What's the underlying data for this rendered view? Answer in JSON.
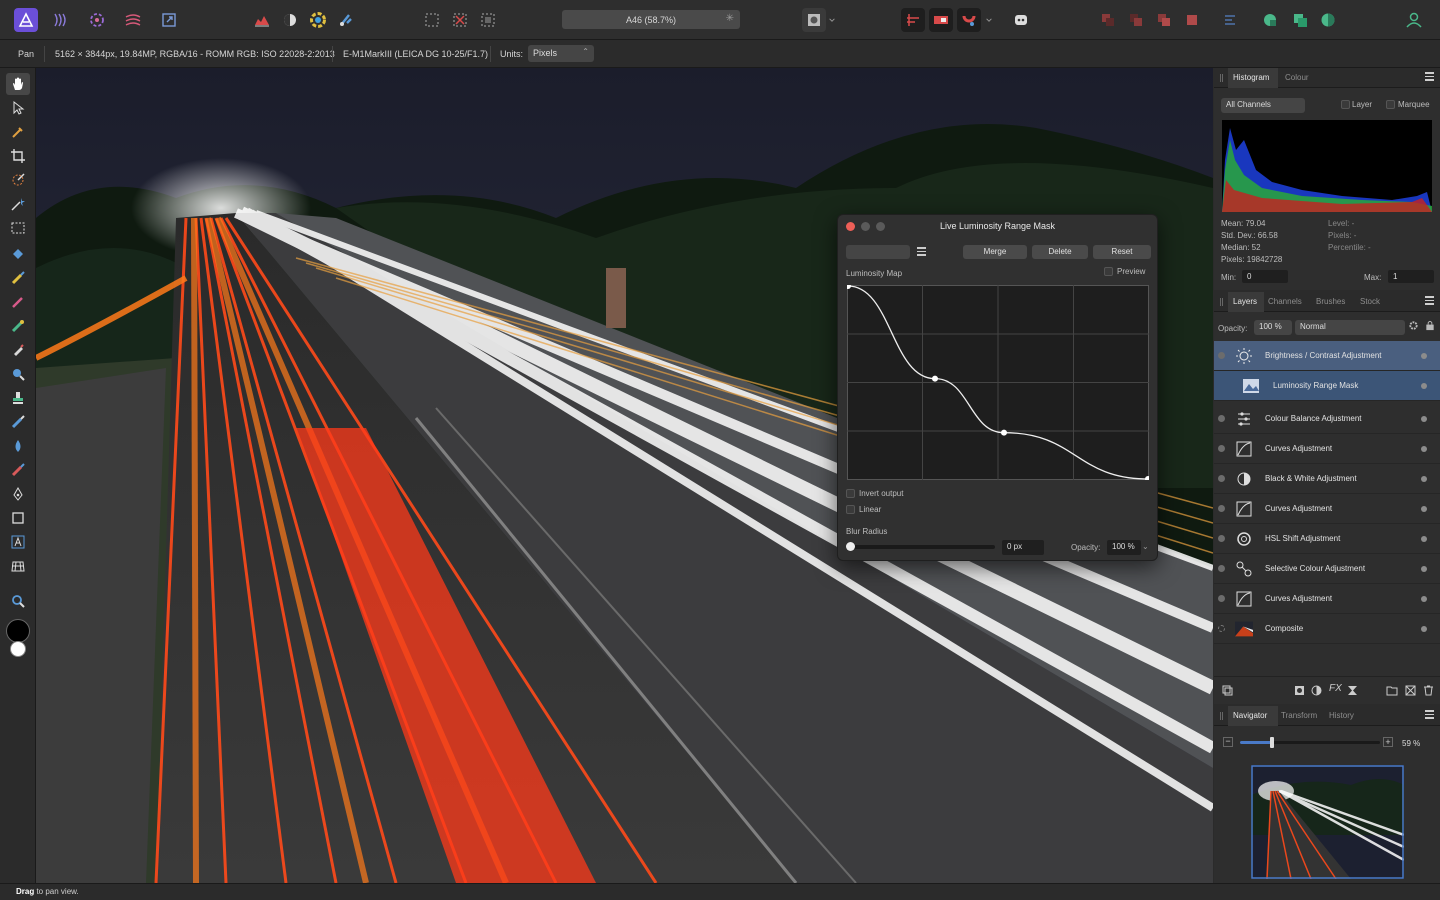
{
  "toolbar_top": {
    "document_title": "A46 (58.7%)",
    "icons": [
      "affinity-photo-logo-icon",
      "liquify-persona-icon",
      "develop-persona-icon",
      "tone-mapping-persona-icon",
      "export-persona-icon",
      "histogram-view-icon",
      "mask-icon",
      "colour-wheel-icon",
      "brush-icon",
      "marquee-select-icon",
      "remove-selection-icon",
      "invert-selection-icon",
      "quick-mask-icon",
      "snapping-icon",
      "view-mode-icon",
      "assistant-icon",
      "arrange-icons",
      "panel-icons",
      "user-icon"
    ]
  },
  "context_bar": {
    "tool": "Pan",
    "image_info": "5162 × 3844px, 19.84MP, RGBA/16 - ROMM RGB: ISO 22028-2:2013",
    "camera": "E-M1MarkIII (LEICA DG 10-25/F1.7)",
    "units_label": "Units:",
    "units_value": "Pixels"
  },
  "status_bar": {
    "bold": "Drag",
    "text": " to pan view."
  },
  "histogram_panel": {
    "tabs": [
      "Histogram",
      "Colour"
    ],
    "channel": "All Channels",
    "layer_label": "Layer",
    "marquee_label": "Marquee",
    "stats_left": [
      "Mean: 79.04",
      "Std. Dev.: 66.58",
      "Median: 52",
      "Pixels: 19842728"
    ],
    "stats_right": [
      "Level: -",
      "Pixels: -",
      "Percentile: -"
    ],
    "min_label": "Min:",
    "min_value": "0",
    "max_label": "Max:",
    "max_value": "1"
  },
  "layers_panel": {
    "tabs": [
      "Layers",
      "Channels",
      "Brushes",
      "Stock"
    ],
    "opacity_label": "Opacity:",
    "opacity_value": "100 %",
    "blend_mode": "Normal",
    "layers": [
      {
        "name": "Brightness / Contrast Adjustment",
        "icon": "brightness-contrast-icon"
      },
      {
        "name": "Luminosity Range Mask",
        "icon": "luminosity-range-mask-icon"
      },
      {
        "name": "Colour Balance Adjustment",
        "icon": "colour-balance-icon"
      },
      {
        "name": "Curves Adjustment",
        "icon": "curves-icon"
      },
      {
        "name": "Black & White Adjustment",
        "icon": "black-white-icon"
      },
      {
        "name": "Curves Adjustment",
        "icon": "curves-icon"
      },
      {
        "name": "HSL Shift Adjustment",
        "icon": "hsl-shift-icon"
      },
      {
        "name": "Selective Colour Adjustment",
        "icon": "selective-colour-icon"
      },
      {
        "name": "Curves Adjustment",
        "icon": "curves-icon"
      },
      {
        "name": "Composite",
        "icon": "pixel-layer-thumbnail"
      }
    ]
  },
  "navigator_panel": {
    "tabs": [
      "Navigator",
      "Transform",
      "History"
    ],
    "zoom_value": "59 %",
    "zoom_fraction": 0.59
  },
  "luminosity_dialog": {
    "title": "Live Luminosity Range Mask",
    "merge_label": "Merge",
    "delete_label": "Delete",
    "reset_label": "Reset",
    "luminosity_map_label": "Luminosity Map",
    "preview_label": "Preview",
    "invert_output_label": "Invert output",
    "linear_label": "Linear",
    "blur_radius_label": "Blur Radius",
    "blur_radius_value": "0 px",
    "opacity_label": "Opacity:",
    "opacity_value": "100 %",
    "curve_points": [
      [
        0,
        1
      ],
      [
        0.29,
        0.52
      ],
      [
        0.52,
        0.24
      ],
      [
        1,
        0
      ]
    ]
  },
  "colors": {
    "accent": "#4a5f7f",
    "selection": "#3c5577",
    "close_button": "#ed5f57"
  }
}
